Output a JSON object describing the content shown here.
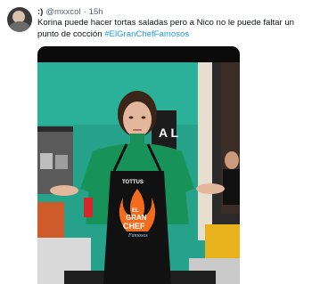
{
  "tweet": {
    "author_name": ":)",
    "handle": "@mxxcol",
    "separator": "·",
    "time": "15h",
    "text_main": "Korina puede hacer tortas saladas pero a Nico no le puede faltar un punto de cocción",
    "hashtag": "#ElGranChefFamosos"
  },
  "media": {
    "apron_brand": "TOTTUS",
    "apron_line1": "EL",
    "apron_line2": "GRAN",
    "apron_line3": "CHEF",
    "apron_line4": "Famosos",
    "sign_letters": "A L"
  }
}
